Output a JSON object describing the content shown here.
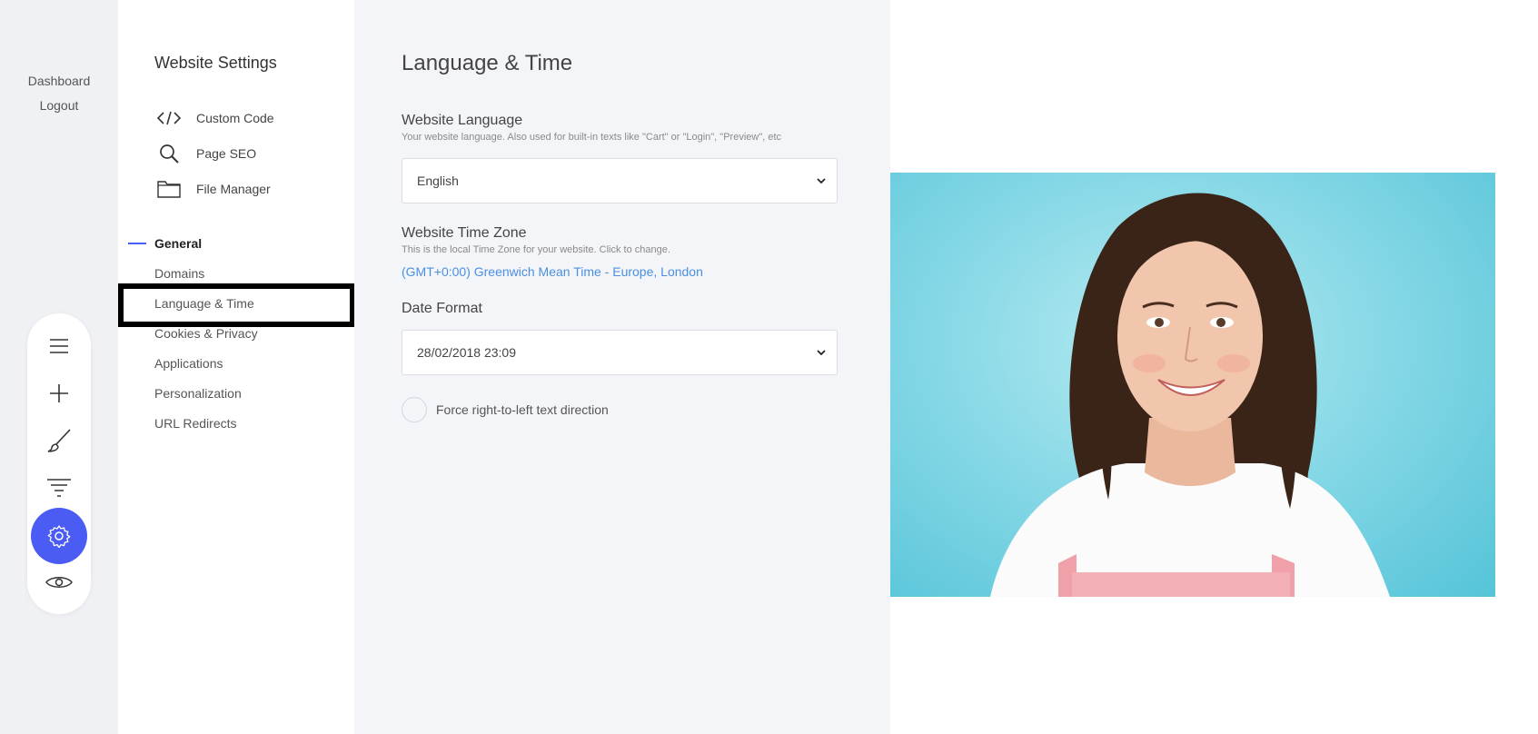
{
  "rail": {
    "dashboard_label": "Dashboard",
    "logout_label": "Logout",
    "tools": [
      "menu-icon",
      "plus-icon",
      "brush-icon",
      "filter-icon",
      "gear-icon",
      "eye-icon"
    ],
    "active_tool": "gear-icon",
    "accent": "#4a5cf3"
  },
  "nav": {
    "title": "Website Settings",
    "tools": [
      {
        "label": "Custom Code",
        "icon": "code-icon"
      },
      {
        "label": "Page SEO",
        "icon": "search-icon"
      },
      {
        "label": "File Manager",
        "icon": "folder-icon"
      }
    ],
    "group_label": "General",
    "items": [
      "Domains",
      "Language & Time",
      "Cookies & Privacy",
      "Applications",
      "Personalization",
      "URL Redirects"
    ],
    "selected_item": "Language & Time"
  },
  "main": {
    "title": "Language & Time",
    "language": {
      "label": "Website Language",
      "help": "Your website language. Also used for built-in texts like \"Cart\" or \"Login\", \"Preview\", etc",
      "value": "English"
    },
    "timezone": {
      "label": "Website Time Zone",
      "help": "This is the local Time Zone for your website. Click to change.",
      "value": "(GMT+0:00) Greenwich Mean Time - Europe, London",
      "link_color": "#4a90e2"
    },
    "date_format": {
      "label": "Date Format",
      "value": "28/02/2018 23:09"
    },
    "rtl": {
      "label": "Force right-to-left text direction",
      "checked": false
    }
  },
  "preview": {
    "topbar_color": "#3c3f4d",
    "photo_background": "#7fd5e4"
  }
}
